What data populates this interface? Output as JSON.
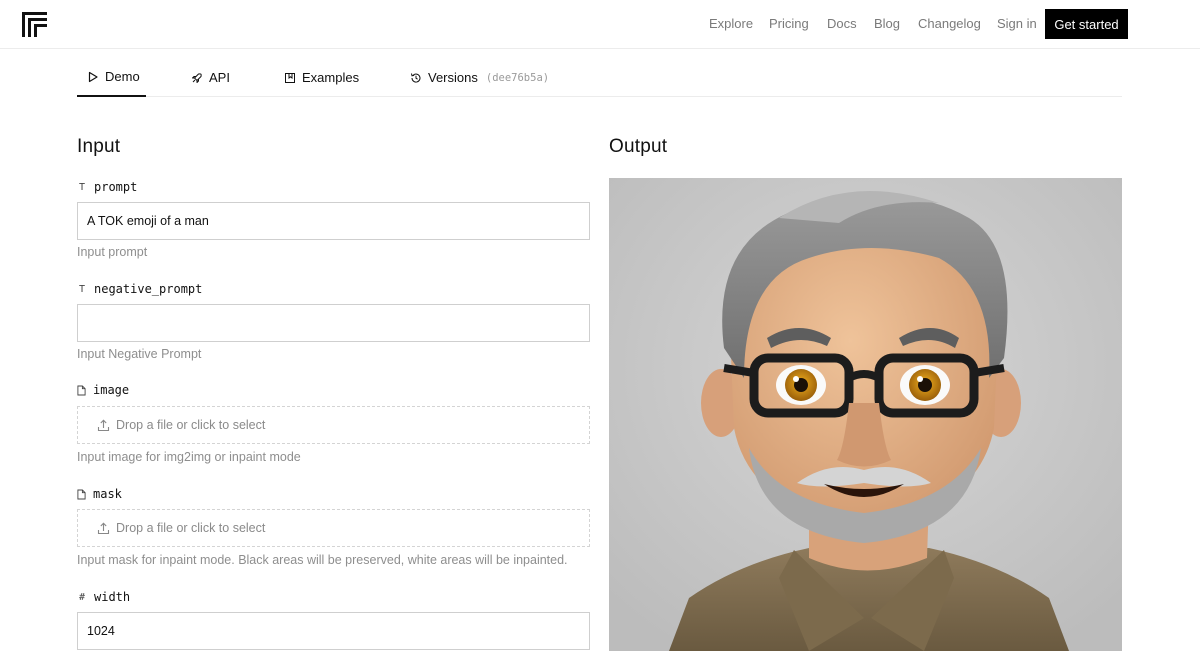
{
  "nav": {
    "links": [
      "Explore",
      "Pricing",
      "Docs",
      "Blog",
      "Changelog",
      "Sign in"
    ],
    "cta": "Get started"
  },
  "tabs": [
    {
      "label": "Demo",
      "icon": "play-icon"
    },
    {
      "label": "API",
      "icon": "rocket-icon"
    },
    {
      "label": "Examples",
      "icon": "bookmark-icon"
    },
    {
      "label": "Versions",
      "icon": "history-icon",
      "hash": "(dee76b5a)"
    }
  ],
  "input": {
    "heading": "Input",
    "fields": {
      "prompt": {
        "icon": "T",
        "name": "prompt",
        "value": "A TOK emoji of a man",
        "help": "Input prompt"
      },
      "negative_prompt": {
        "icon": "T",
        "name": "negative_prompt",
        "value": "",
        "help": "Input Negative Prompt"
      },
      "image": {
        "name": "image",
        "dropzone": "Drop a file or click to select",
        "help": "Input image for img2img or inpaint mode"
      },
      "mask": {
        "name": "mask",
        "dropzone": "Drop a file or click to select",
        "help": "Input mask for inpaint mode. Black areas will be preserved, white areas will be inpainted."
      },
      "width": {
        "icon": "#",
        "name": "width",
        "value": "1024"
      }
    }
  },
  "output": {
    "heading": "Output",
    "image_subject": "emoji-style portrait of a gray-haired man with glasses and beard in a khaki shirt"
  }
}
